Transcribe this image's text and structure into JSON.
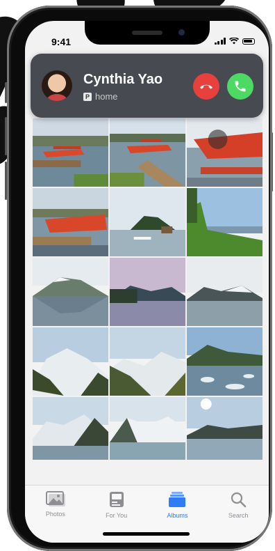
{
  "status_bar": {
    "time": "9:41"
  },
  "incoming_call": {
    "caller_name": "Cynthia Yao",
    "badge": "P",
    "subtitle": "home",
    "decline_color": "#e8403c",
    "accept_color": "#4cd964"
  },
  "photos": [
    {
      "scene": "red seaplane at dock"
    },
    {
      "scene": "red seaplane on wooden pier"
    },
    {
      "scene": "red seaplane close-up"
    },
    {
      "scene": "red seaplane on water"
    },
    {
      "scene": "lake cabin with white seaplane"
    },
    {
      "scene": "green hillside over fjord"
    },
    {
      "scene": "snowy mountain reflected in lake"
    },
    {
      "scene": "mountains at dusk over lake"
    },
    {
      "scene": "glacier bay with clouds"
    },
    {
      "scene": "snowy peaks and glacier"
    },
    {
      "scene": "glacier valley"
    },
    {
      "scene": "icebergs in bay"
    },
    {
      "scene": "snowy mountain ridge"
    },
    {
      "scene": "glacier with blue sky"
    },
    {
      "scene": "sun over glacier lake"
    }
  ],
  "tabbar": {
    "tabs": [
      {
        "label": "Photos",
        "icon": "photos-icon",
        "active": false
      },
      {
        "label": "For You",
        "icon": "for-you-icon",
        "active": false
      },
      {
        "label": "Albums",
        "icon": "albums-icon",
        "active": true
      },
      {
        "label": "Search",
        "icon": "search-icon",
        "active": false
      }
    ],
    "active_color": "#2f7cf6",
    "inactive_color": "#8e8e93"
  }
}
